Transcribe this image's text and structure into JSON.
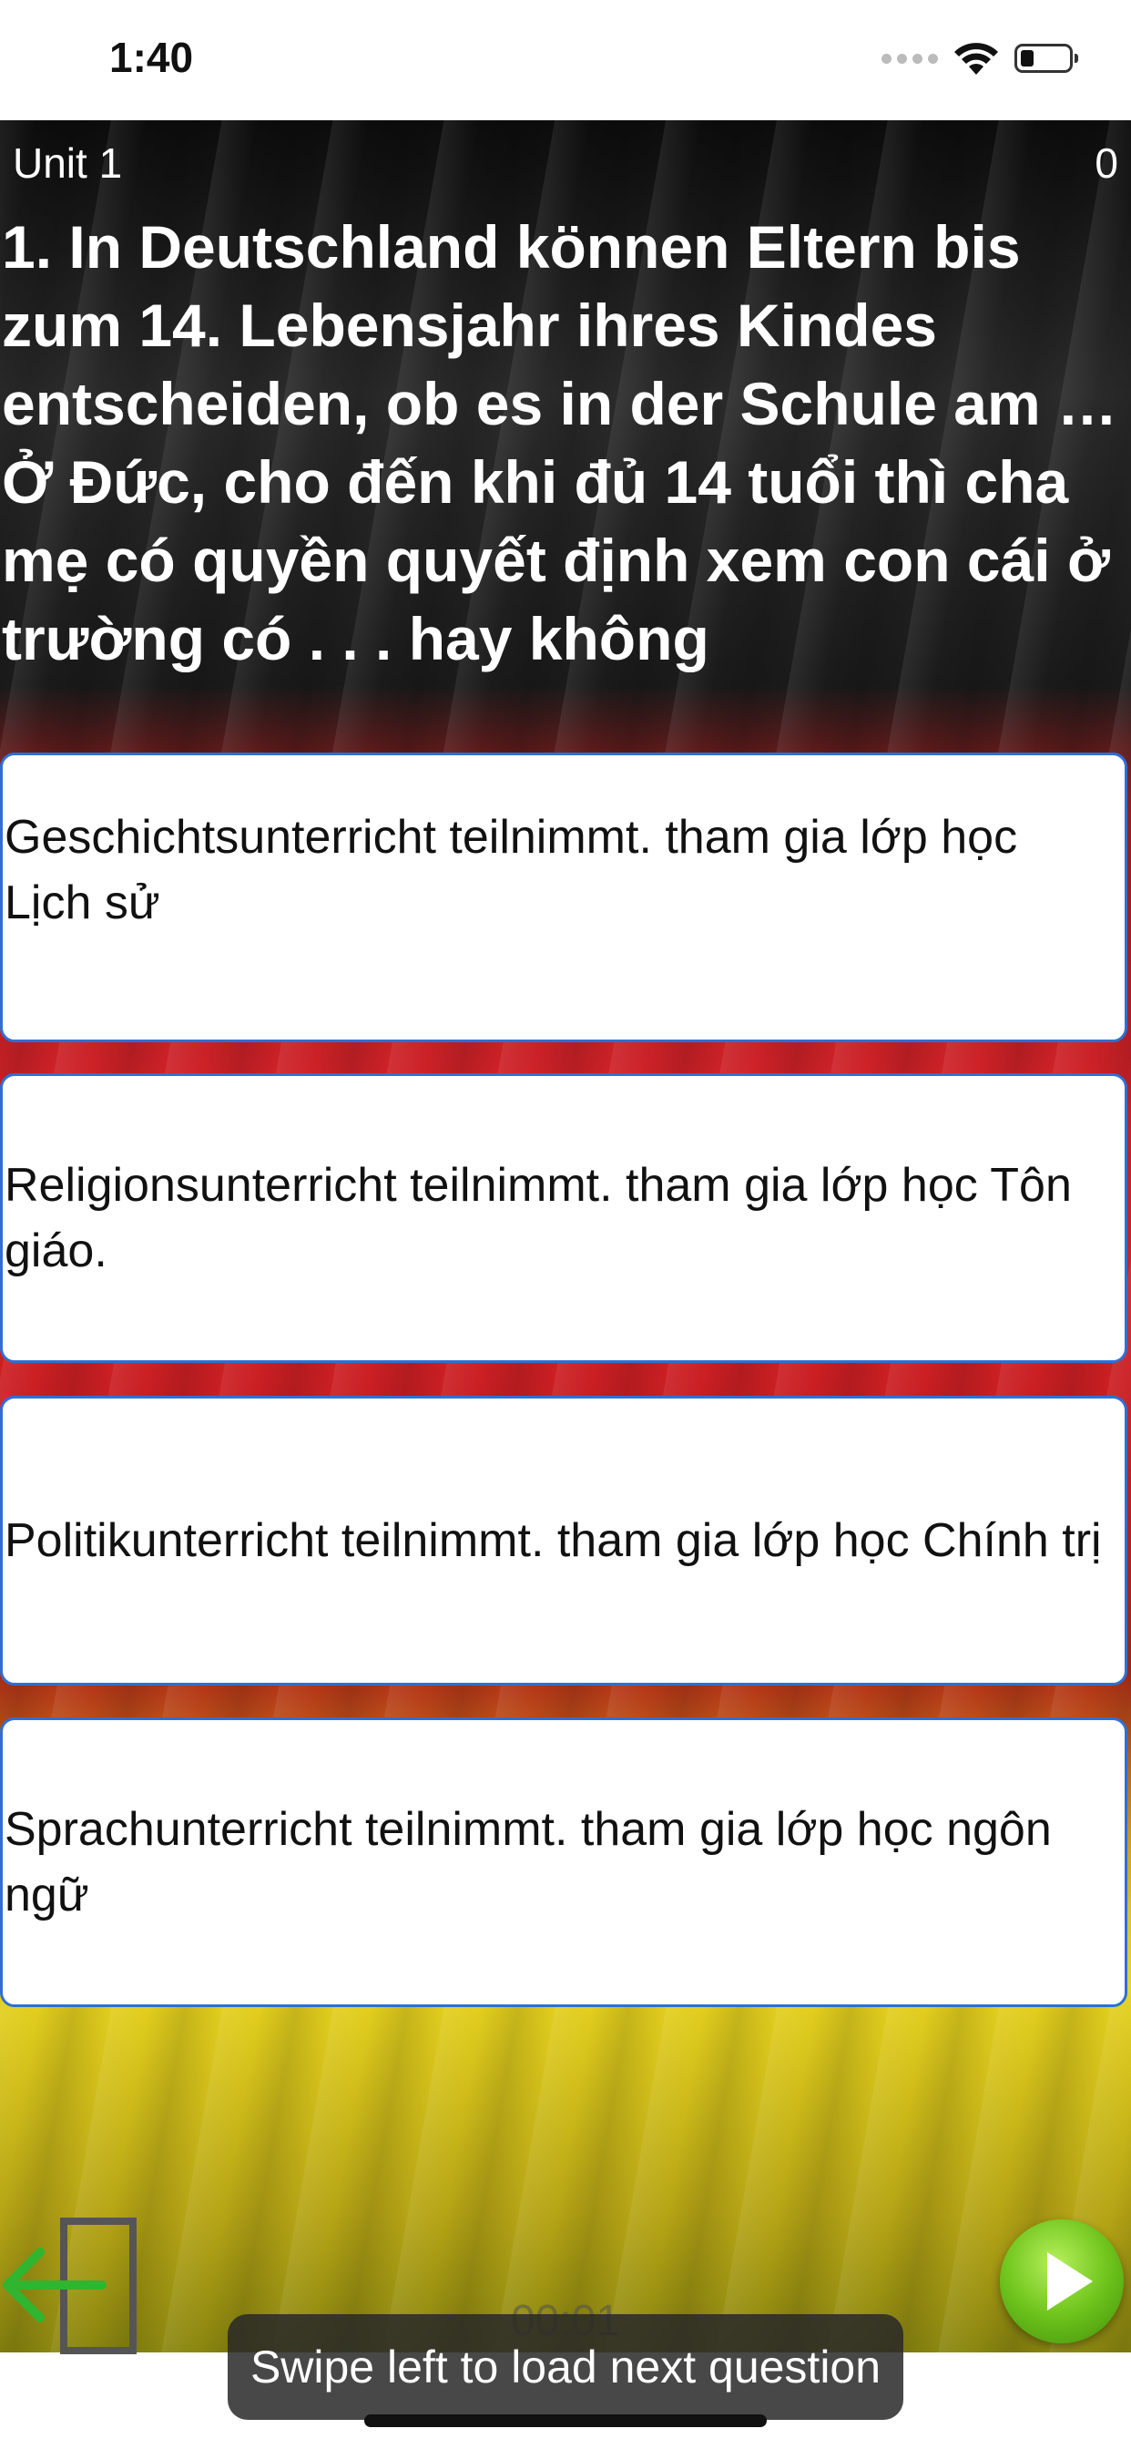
{
  "status_bar": {
    "time": "1:40"
  },
  "header": {
    "unit": "Unit 1",
    "score": "0"
  },
  "question": {
    "text": "1. In Deutschland können Eltern bis zum 14. Lebensjahr ihres Kindes entscheiden, ob es in der Schule am …\n Ở Đức, cho đến khi đủ 14 tuổi thì cha mẹ có quyền quyết định xem con cái ở trường có . . . hay không"
  },
  "answers": [
    {
      "text": "Geschichtsunterricht teilnimmt. tham gia lớp học Lịch sử"
    },
    {
      "text": "Religionsunterricht teilnimmt. tham gia lớp học Tôn giáo."
    },
    {
      "text": "Politikunterricht teilnimmt. tham gia lớp học Chính trị"
    },
    {
      "text": "Sprachunterricht teilnimmt. tham gia lớp học ngôn ngữ"
    }
  ],
  "footer": {
    "timer": "00:01",
    "toast": "Swipe left to load next question",
    "exit_icon": "exit-arrow-icon",
    "next_icon": "play-icon"
  },
  "colors": {
    "answer_border": "#2f6fd6",
    "next_button": "#6fc41c",
    "exit_arrow": "#2fb52f"
  }
}
